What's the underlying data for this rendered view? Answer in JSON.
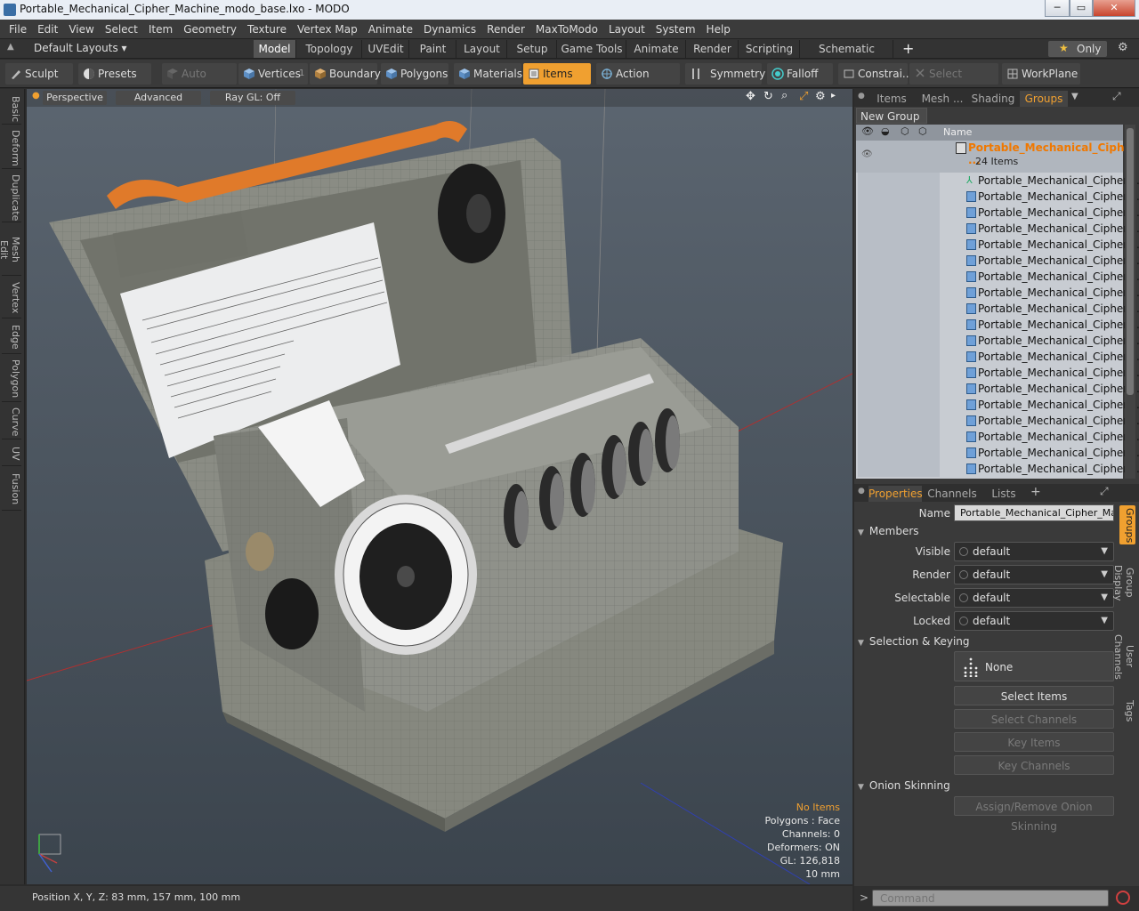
{
  "window": {
    "title": "Portable_Mechanical_Cipher_Machine_modo_base.lxo - MODO",
    "buttons": [
      "─",
      "▭",
      "✕"
    ]
  },
  "menubar": [
    "File",
    "Edit",
    "View",
    "Select",
    "Item",
    "Geometry",
    "Texture",
    "Vertex Map",
    "Animate",
    "Dynamics",
    "Render",
    "MaxToModo",
    "Layout",
    "System",
    "Help"
  ],
  "layoutbar": {
    "layouts_label": "Default Layouts ▾",
    "tabs": [
      "Model",
      "Topology",
      "UVEdit",
      "Paint",
      "Layout",
      "Setup",
      "Game Tools",
      "Animate",
      "Render",
      "Scripting",
      "Schematic Fusion"
    ],
    "active_tab": "Model",
    "plus": "+",
    "only_label": "Only",
    "star": "★"
  },
  "toolbar": {
    "sculpt": "Sculpt",
    "presets": "Presets",
    "auto_select": "Auto Select",
    "vertices": "Vertices",
    "vertices_count": "1",
    "boundary": "Boundary",
    "polygons": "Polygons",
    "materials": "Materials",
    "items": "Items",
    "action_center": "Action Center",
    "symmetry": "Symmetry",
    "falloff": "Falloff",
    "constraints": "Constrai...",
    "select_through": "Select Through",
    "workplane": "WorkPlane"
  },
  "left_tabs": [
    "Basic",
    "Deform",
    "Duplicate",
    "Mesh Edit",
    "Vertex",
    "Edge",
    "Polygon",
    "Curve",
    "UV",
    "Fusion"
  ],
  "viewport": {
    "perspective": "Perspective",
    "advanced": "Advanced",
    "raygl": "Ray GL: Off",
    "hud": {
      "no_items": "No Items",
      "polygons": "Polygons : Face",
      "channels": "Channels: 0",
      "deformers": "Deformers: ON",
      "gl": "GL: 126,818",
      "scale": "10 mm"
    }
  },
  "statusbar": {
    "position": "Position X, Y, Z:   83 mm, 157 mm, 100 mm"
  },
  "groups_panel": {
    "tabs": [
      "Items",
      "Mesh ...",
      "Shading",
      "Groups"
    ],
    "active_tab": "Groups",
    "new_group": "New Group",
    "name_header": "Name",
    "group_name": "Portable_Mechanical_Ciphe ...",
    "item_count": "24 Items",
    "items": [
      "Portable_Mechanical_Cipher_ ...",
      "Portable_Mechanical_Cipher_ ...",
      "Portable_Mechanical_Cipher_ ...",
      "Portable_Mechanical_Cipher_ ...",
      "Portable_Mechanical_Cipher_ ...",
      "Portable_Mechanical_Cipher_ ...",
      "Portable_Mechanical_Cipher_ ...",
      "Portable_Mechanical_Cipher_ ...",
      "Portable_Mechanical_Cipher_ ...",
      "Portable_Mechanical_Cipher_ ...",
      "Portable_Mechanical_Cipher_ ...",
      "Portable_Mechanical_Cipher_ ...",
      "Portable_Mechanical_Cipher_ ...",
      "Portable_Mechanical_Cipher_ ...",
      "Portable_Mechanical_Cipher_ ...",
      "Portable_Mechanical_Cipher_ ...",
      "Portable_Mechanical_Cipher_ ...",
      "Portable_Mechanical_Cipher_ ...",
      "Portable_Mechanical_Cipher_ ..."
    ]
  },
  "properties_panel": {
    "tabs": [
      "Properties",
      "Channels",
      "Lists"
    ],
    "active_tab": "Properties",
    "plus": "+",
    "name_label": "Name",
    "name_value": "Portable_Mechanical_Cipher_Mach",
    "members_section": "Members",
    "visible_label": "Visible",
    "visible_value": "default",
    "render_label": "Render",
    "render_value": "default",
    "selectable_label": "Selectable",
    "selectable_value": "default",
    "locked_label": "Locked",
    "locked_value": "default",
    "selection_section": "Selection & Keying",
    "none_label": "None",
    "select_items": "Select Items",
    "select_channels": "Select Channels",
    "key_items": "Key Items",
    "key_channels": "Key Channels",
    "onion_section": "Onion Skinning",
    "assign_onion": "Assign/Remove Onion Skinning",
    "side_tabs": [
      "Groups",
      "Group Display",
      "User Channels",
      "Tags"
    ]
  },
  "command": {
    "placeholder": "Command",
    "prompt": ">"
  }
}
